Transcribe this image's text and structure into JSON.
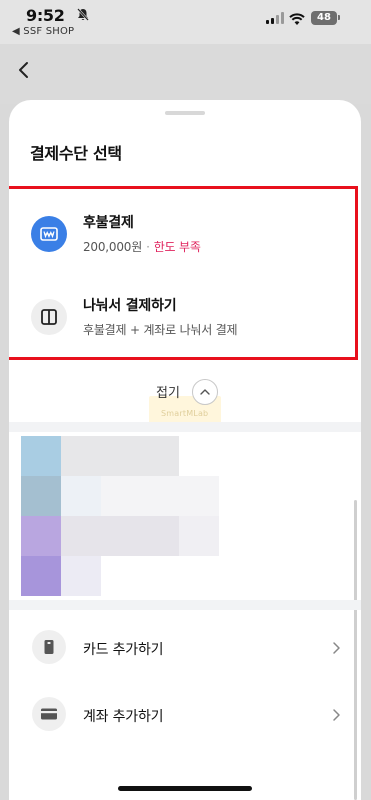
{
  "status_bar": {
    "time": "9:52",
    "back_app": "◀ SSF SHOP",
    "battery": "48",
    "icons": [
      "bell-muted-icon",
      "signal-icon",
      "wifi-icon",
      "battery-icon"
    ]
  },
  "header": {
    "back_icon": "chevron-left-icon"
  },
  "sheet": {
    "title": "결제수단 선택",
    "options": [
      {
        "title": "후불결제",
        "amount": "200,000원",
        "separator": "·",
        "status": "한도 부족",
        "icon": "won-card-icon"
      },
      {
        "title": "나눠서 결제하기",
        "subtitle": "후불결제 + 계좌로 나눠서 결제",
        "icon": "split-panel-icon"
      }
    ],
    "collapse_label": "접기",
    "watermark": "SmartMLab",
    "add_items": [
      {
        "label": "카드 추가하기",
        "icon": "card-icon"
      },
      {
        "label": "계좌 추가하기",
        "icon": "bank-account-icon"
      }
    ]
  },
  "colors": {
    "accent_blue": "#3a7fe6",
    "limit_red": "#e0245e",
    "highlight_red": "#e8101c"
  }
}
